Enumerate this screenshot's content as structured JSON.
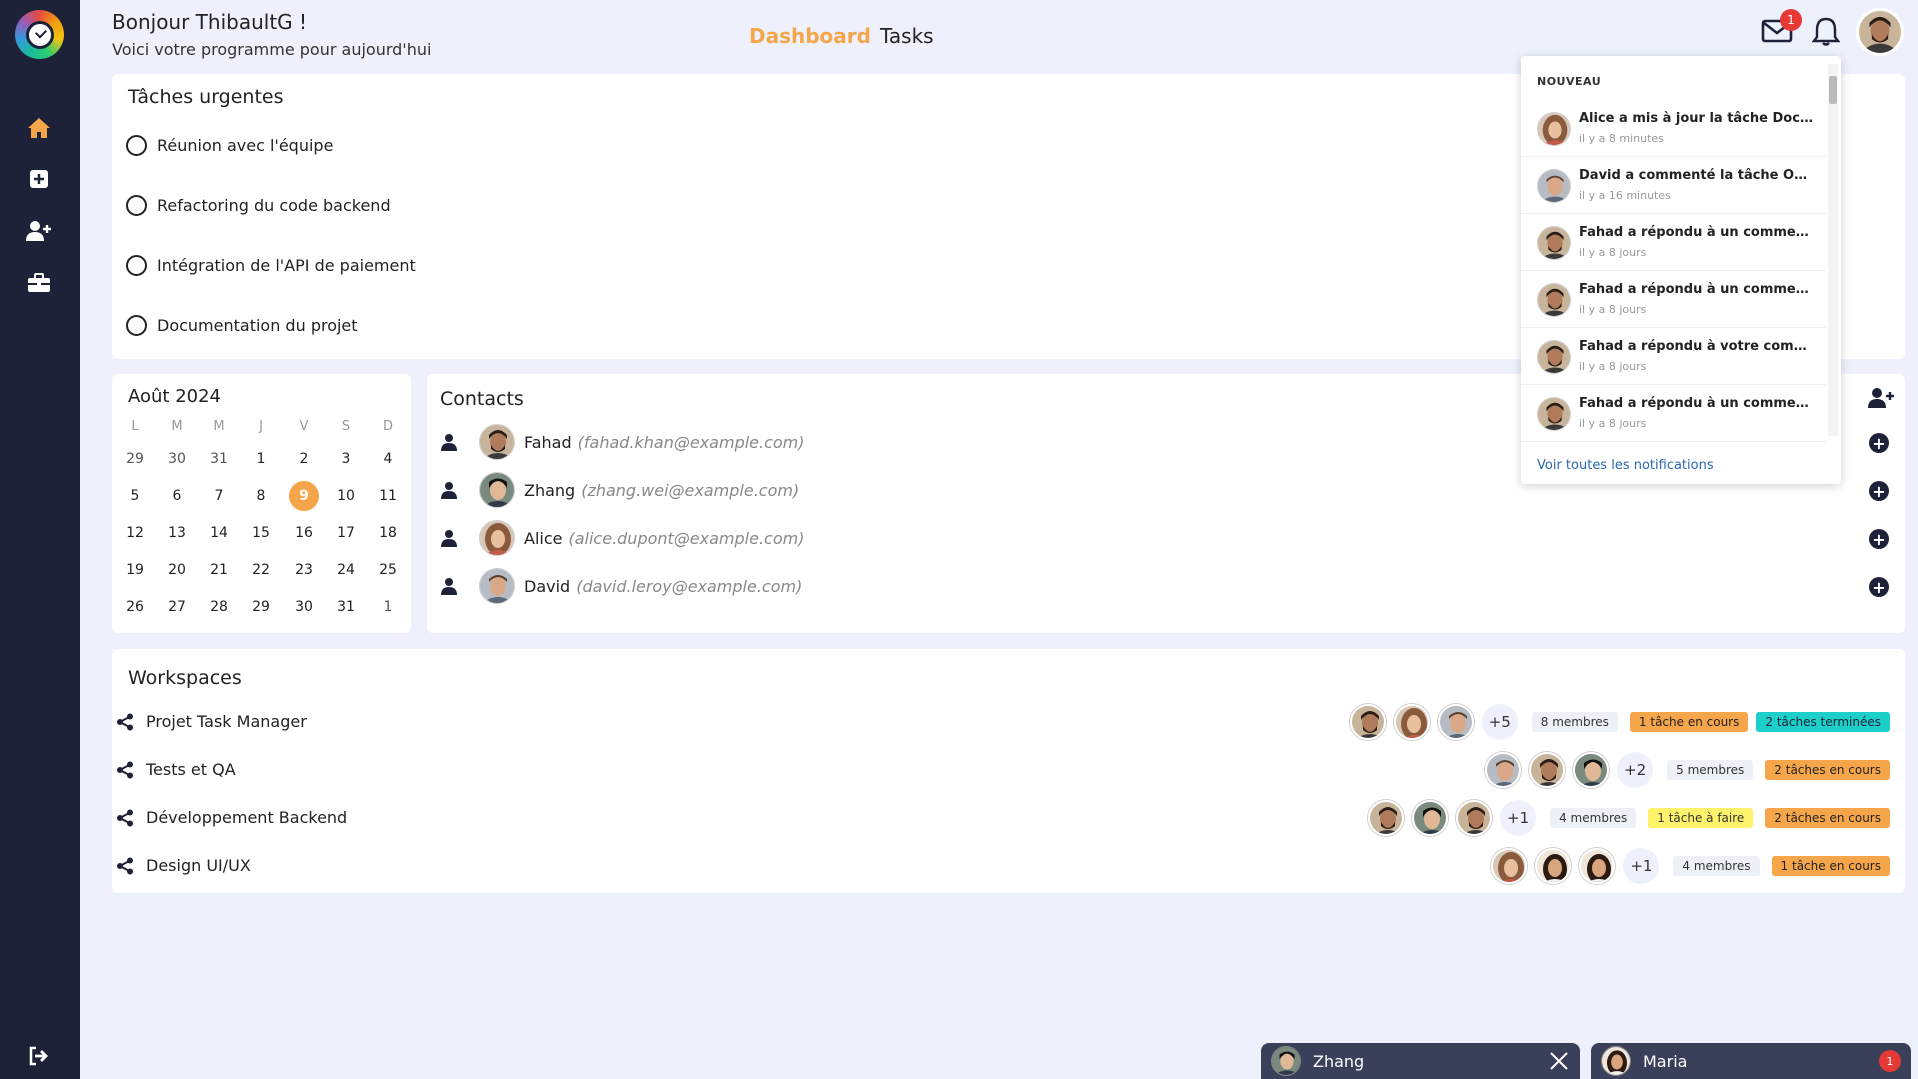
{
  "sidebar": {
    "logo": "app-logo",
    "items": [
      {
        "name": "home-icon",
        "color": "#f5a54a"
      },
      {
        "name": "add-square-icon",
        "color": "#ffffff"
      },
      {
        "name": "add-user-icon",
        "color": "#ffffff"
      },
      {
        "name": "briefcase-icon",
        "color": "#ffffff"
      }
    ],
    "logout": "logout-icon"
  },
  "header": {
    "greeting": "Bonjour ThibaultG !",
    "subtitle": "Voici votre programme pour aujourd'hui",
    "tabs": [
      {
        "label": "Dashboard",
        "active": true
      },
      {
        "label": "Tasks",
        "active": false
      }
    ],
    "mail_badge": "1"
  },
  "urgent_tasks": {
    "title": "Tâches urgentes",
    "items": [
      "Réunion avec l'équipe",
      "Refactoring du code backend",
      "Intégration de l'API de paiement",
      "Documentation du projet"
    ]
  },
  "calendar": {
    "month": "Août 2024",
    "weekdays": [
      "L",
      "M",
      "M",
      "J",
      "V",
      "S",
      "D"
    ],
    "weeks": [
      [
        "29",
        "30",
        "31",
        "1",
        "2",
        "3",
        "4"
      ],
      [
        "5",
        "6",
        "7",
        "8",
        "9",
        "10",
        "11"
      ],
      [
        "12",
        "13",
        "14",
        "15",
        "16",
        "17",
        "18"
      ],
      [
        "19",
        "20",
        "21",
        "22",
        "23",
        "24",
        "25"
      ],
      [
        "26",
        "27",
        "28",
        "29",
        "30",
        "31",
        "1"
      ]
    ],
    "today": "9"
  },
  "contacts": {
    "title": "Contacts",
    "items": [
      {
        "name": "Fahad",
        "email": "(fahad.khan@example.com)"
      },
      {
        "name": "Zhang",
        "email": "(zhang.wei@example.com)"
      },
      {
        "name": "Alice",
        "email": "(alice.dupont@example.com)"
      },
      {
        "name": "David",
        "email": "(david.leroy@example.com)"
      }
    ]
  },
  "workspaces": {
    "title": "Workspaces",
    "items": [
      {
        "name": "Projet Task Manager",
        "more": "+5",
        "members": "8 membres",
        "chips": [
          {
            "label": "1 tâche en cours",
            "kind": "orange"
          },
          {
            "label": "2 tâches terminées",
            "kind": "teal"
          }
        ]
      },
      {
        "name": "Tests et QA",
        "more": "+2",
        "members": "5 membres",
        "chips": [
          {
            "label": "2 tâches en cours",
            "kind": "orange"
          }
        ]
      },
      {
        "name": "Développement Backend",
        "more": "+1",
        "members": "4 membres",
        "chips": [
          {
            "label": "1 tâche à faire",
            "kind": "yellow"
          },
          {
            "label": "2 tâches en cours",
            "kind": "orange"
          }
        ]
      },
      {
        "name": "Design UI/UX",
        "more": "+1",
        "members": "4 membres",
        "chips": [
          {
            "label": "1 tâche en cours",
            "kind": "orange"
          }
        ]
      }
    ]
  },
  "notifications": {
    "header": "NOUVEAU",
    "items": [
      {
        "text": "Alice a mis à jour la tâche Documentation du projet",
        "time": "il y a 8 minutes"
      },
      {
        "text": "David a commenté la tâche Optimisation",
        "time": "il y a 16 minutes"
      },
      {
        "text": "Fahad a répondu à un commentaire",
        "time": "il y a 8 jours"
      },
      {
        "text": "Fahad a répondu à un commentaire",
        "time": "il y a 8 jours"
      },
      {
        "text": "Fahad a répondu à votre commentaire",
        "time": "il y a 8 jours"
      },
      {
        "text": "Fahad a répondu à un commentaire",
        "time": "il y a 8 jours"
      }
    ],
    "footer": "Voir toutes les notifications"
  },
  "chat_tabs": [
    {
      "name": "Zhang",
      "action": "close-icon"
    },
    {
      "name": "Maria",
      "badge": "1"
    }
  ],
  "colors": {
    "accent": "#f5a54a",
    "sidebar": "#1e2238",
    "background": "#eef1fb",
    "badge": "#e53935",
    "teal": "#1ccfc9"
  }
}
